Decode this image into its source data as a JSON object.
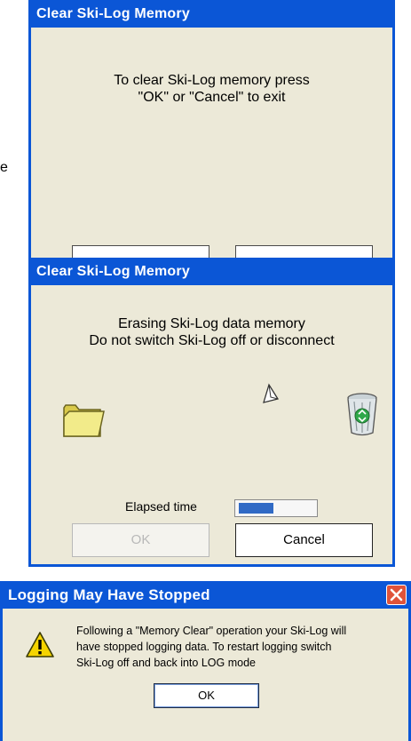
{
  "stray_text": "e",
  "dialog1": {
    "title": "Clear Ski-Log Memory",
    "message_line1": "To clear Ski-Log memory press",
    "message_line2": "\"OK\" or \"Cancel\" to exit"
  },
  "dialog2": {
    "title": "Clear Ski-Log Memory",
    "message_line1": "Erasing Ski-Log data memory",
    "message_line2": "Do not switch Ski-Log off or disconnect",
    "elapsed_label": "Elapsed time",
    "progress": 0.45,
    "ok_label": "OK",
    "cancel_label": "Cancel",
    "icons": [
      "folder-icon",
      "flying-paper-icon",
      "recycle-bin-icon"
    ]
  },
  "dialog3": {
    "title": "Logging May Have Stopped",
    "message_line1": "Following a \"Memory Clear\" operation your Ski-Log will",
    "message_line2": "have stopped logging data. To restart logging switch",
    "message_line3": "Ski-Log off and back into LOG mode",
    "ok_label": "OK",
    "icons": [
      "warning-icon",
      "close-icon"
    ]
  },
  "colors": {
    "titlebar": "#0b56d6",
    "dialog_bg": "#ece9d8",
    "progress_fill": "#316ac5",
    "close_button": "#e0533a",
    "warning": "#f5d400"
  }
}
